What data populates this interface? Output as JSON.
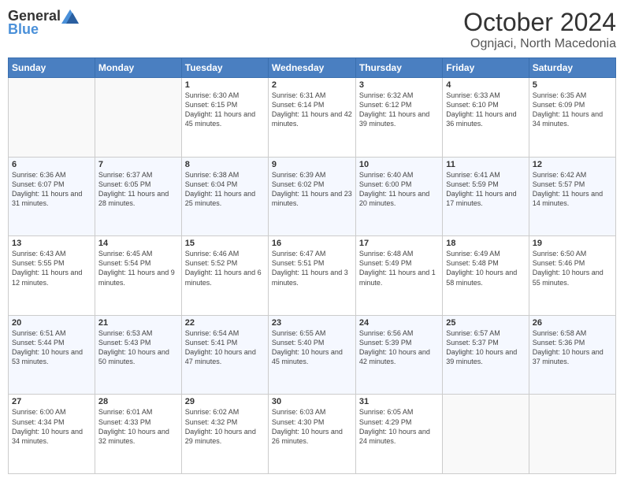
{
  "header": {
    "logo_general": "General",
    "logo_blue": "Blue",
    "title": "October 2024",
    "subtitle": "Ognjaci, North Macedonia"
  },
  "columns": [
    "Sunday",
    "Monday",
    "Tuesday",
    "Wednesday",
    "Thursday",
    "Friday",
    "Saturday"
  ],
  "weeks": [
    [
      {
        "day": "",
        "info": ""
      },
      {
        "day": "",
        "info": ""
      },
      {
        "day": "1",
        "info": "Sunrise: 6:30 AM\nSunset: 6:15 PM\nDaylight: 11 hours and 45 minutes."
      },
      {
        "day": "2",
        "info": "Sunrise: 6:31 AM\nSunset: 6:14 PM\nDaylight: 11 hours and 42 minutes."
      },
      {
        "day": "3",
        "info": "Sunrise: 6:32 AM\nSunset: 6:12 PM\nDaylight: 11 hours and 39 minutes."
      },
      {
        "day": "4",
        "info": "Sunrise: 6:33 AM\nSunset: 6:10 PM\nDaylight: 11 hours and 36 minutes."
      },
      {
        "day": "5",
        "info": "Sunrise: 6:35 AM\nSunset: 6:09 PM\nDaylight: 11 hours and 34 minutes."
      }
    ],
    [
      {
        "day": "6",
        "info": "Sunrise: 6:36 AM\nSunset: 6:07 PM\nDaylight: 11 hours and 31 minutes."
      },
      {
        "day": "7",
        "info": "Sunrise: 6:37 AM\nSunset: 6:05 PM\nDaylight: 11 hours and 28 minutes."
      },
      {
        "day": "8",
        "info": "Sunrise: 6:38 AM\nSunset: 6:04 PM\nDaylight: 11 hours and 25 minutes."
      },
      {
        "day": "9",
        "info": "Sunrise: 6:39 AM\nSunset: 6:02 PM\nDaylight: 11 hours and 23 minutes."
      },
      {
        "day": "10",
        "info": "Sunrise: 6:40 AM\nSunset: 6:00 PM\nDaylight: 11 hours and 20 minutes."
      },
      {
        "day": "11",
        "info": "Sunrise: 6:41 AM\nSunset: 5:59 PM\nDaylight: 11 hours and 17 minutes."
      },
      {
        "day": "12",
        "info": "Sunrise: 6:42 AM\nSunset: 5:57 PM\nDaylight: 11 hours and 14 minutes."
      }
    ],
    [
      {
        "day": "13",
        "info": "Sunrise: 6:43 AM\nSunset: 5:55 PM\nDaylight: 11 hours and 12 minutes."
      },
      {
        "day": "14",
        "info": "Sunrise: 6:45 AM\nSunset: 5:54 PM\nDaylight: 11 hours and 9 minutes."
      },
      {
        "day": "15",
        "info": "Sunrise: 6:46 AM\nSunset: 5:52 PM\nDaylight: 11 hours and 6 minutes."
      },
      {
        "day": "16",
        "info": "Sunrise: 6:47 AM\nSunset: 5:51 PM\nDaylight: 11 hours and 3 minutes."
      },
      {
        "day": "17",
        "info": "Sunrise: 6:48 AM\nSunset: 5:49 PM\nDaylight: 11 hours and 1 minute."
      },
      {
        "day": "18",
        "info": "Sunrise: 6:49 AM\nSunset: 5:48 PM\nDaylight: 10 hours and 58 minutes."
      },
      {
        "day": "19",
        "info": "Sunrise: 6:50 AM\nSunset: 5:46 PM\nDaylight: 10 hours and 55 minutes."
      }
    ],
    [
      {
        "day": "20",
        "info": "Sunrise: 6:51 AM\nSunset: 5:44 PM\nDaylight: 10 hours and 53 minutes."
      },
      {
        "day": "21",
        "info": "Sunrise: 6:53 AM\nSunset: 5:43 PM\nDaylight: 10 hours and 50 minutes."
      },
      {
        "day": "22",
        "info": "Sunrise: 6:54 AM\nSunset: 5:41 PM\nDaylight: 10 hours and 47 minutes."
      },
      {
        "day": "23",
        "info": "Sunrise: 6:55 AM\nSunset: 5:40 PM\nDaylight: 10 hours and 45 minutes."
      },
      {
        "day": "24",
        "info": "Sunrise: 6:56 AM\nSunset: 5:39 PM\nDaylight: 10 hours and 42 minutes."
      },
      {
        "day": "25",
        "info": "Sunrise: 6:57 AM\nSunset: 5:37 PM\nDaylight: 10 hours and 39 minutes."
      },
      {
        "day": "26",
        "info": "Sunrise: 6:58 AM\nSunset: 5:36 PM\nDaylight: 10 hours and 37 minutes."
      }
    ],
    [
      {
        "day": "27",
        "info": "Sunrise: 6:00 AM\nSunset: 4:34 PM\nDaylight: 10 hours and 34 minutes."
      },
      {
        "day": "28",
        "info": "Sunrise: 6:01 AM\nSunset: 4:33 PM\nDaylight: 10 hours and 32 minutes."
      },
      {
        "day": "29",
        "info": "Sunrise: 6:02 AM\nSunset: 4:32 PM\nDaylight: 10 hours and 29 minutes."
      },
      {
        "day": "30",
        "info": "Sunrise: 6:03 AM\nSunset: 4:30 PM\nDaylight: 10 hours and 26 minutes."
      },
      {
        "day": "31",
        "info": "Sunrise: 6:05 AM\nSunset: 4:29 PM\nDaylight: 10 hours and 24 minutes."
      },
      {
        "day": "",
        "info": ""
      },
      {
        "day": "",
        "info": ""
      }
    ]
  ]
}
